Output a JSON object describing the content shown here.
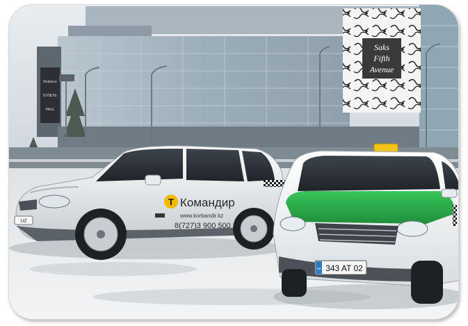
{
  "store_sign": {
    "line1": "Saks",
    "line2": "Fifth",
    "line3": "Avenue"
  },
  "pole_sign": {
    "line1": "Reliance",
    "line2": "КУПЕЛЬ",
    "line3": "PAUL"
  },
  "suv_left": {
    "brand": "Командир",
    "brand_icon_letter": "Т",
    "website": "www.korbandir.kz",
    "phone": "8(727)3 900 500",
    "plate": "UZ"
  },
  "suv_right": {
    "roof_light_color": "#f2c318",
    "plate": "343 AT 02",
    "plate_country": "KZ",
    "hood_color": "#2fb04a"
  },
  "colors": {
    "sky": "#dde3e8",
    "building_glass": "#9fb0bd",
    "snow": "#eef0f2",
    "car_body": "#f4f5f6",
    "brand_yellow": "#f3b800"
  }
}
